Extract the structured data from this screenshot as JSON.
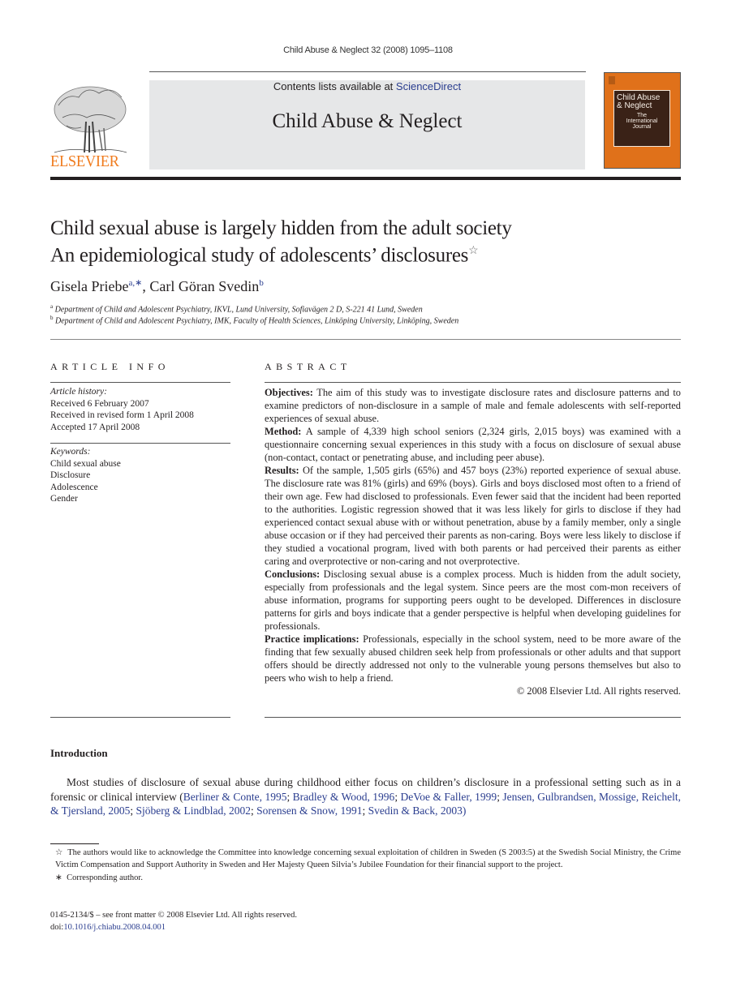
{
  "running_head": "Child Abuse & Neglect 32 (2008) 1095–1108",
  "banner": {
    "publisher_logo_text": "ELSEVIER",
    "contents_prefix": "Contents lists available at ",
    "contents_link": "ScienceDirect",
    "journal_name": "Child Abuse & Neglect",
    "cover": {
      "title_line1": "Child Abuse",
      "title_line2": "& Neglect",
      "subtitle_line1": "The",
      "subtitle_line2": "International",
      "subtitle_line3": "Journal"
    },
    "colors": {
      "logo_orange": "#f07b1d",
      "cover_orange": "#e0711a",
      "cover_brown": "#3a2217",
      "banner_gray": "#e6e7e8",
      "link_blue": "#2a3d8f"
    }
  },
  "article": {
    "title_line1": "Child sexual abuse is largely hidden from the adult society",
    "title_line2": "An epidemiological study of adolescents’ disclosures",
    "title_footnote_mark": "☆",
    "authors": [
      {
        "name": "Gisela Priebe",
        "marks": "a,∗"
      },
      {
        "name": "Carl Göran Svedin",
        "marks": "b"
      }
    ],
    "author_separator": ", ",
    "affiliations": [
      {
        "mark": "a",
        "text": "Department of Child and Adolescent Psychiatry, IKVL, Lund University, Sofiavägen 2 D, S-221 41 Lund, Sweden"
      },
      {
        "mark": "b",
        "text": "Department of Child and Adolescent Psychiatry, IMK, Faculty of Health Sciences, Linköping University, Linköping, Sweden"
      }
    ]
  },
  "article_info": {
    "heading": "ARTICLE INFO",
    "history_label": "Article history:",
    "history": [
      "Received 6 February 2007",
      "Received in revised form 1 April 2008",
      "Accepted 17 April 2008"
    ],
    "keywords_label": "Keywords:",
    "keywords": [
      "Child sexual abuse",
      "Disclosure",
      "Adolescence",
      "Gender"
    ]
  },
  "abstract": {
    "heading": "ABSTRACT",
    "sections": [
      {
        "label": "Objectives:",
        "text": " The aim of this study was to investigate disclosure rates and disclosure patterns and to examine predictors of non-disclosure in a sample of male and female adolescents with self-reported experiences of sexual abuse."
      },
      {
        "label": "Method:",
        "text": " A sample of 4,339 high school seniors (2,324 girls, 2,015 boys) was examined with a questionnaire concerning sexual experiences in this study with a focus on disclosure of sexual abuse (non-contact, contact or penetrating abuse, and including peer abuse)."
      },
      {
        "label": "Results:",
        "text": " Of the sample, 1,505 girls (65%) and 457 boys (23%) reported experience of sexual abuse. The disclosure rate was 81% (girls) and 69% (boys). Girls and boys disclosed most often to a friend of their own age. Few had disclosed to professionals. Even fewer said that the incident had been reported to the authorities. Logistic regression showed that it was less likely for girls to disclose if they had experienced contact sexual abuse with or without penetration, abuse by a family member, only a single abuse occasion or if they had perceived their parents as non-caring. Boys were less likely to disclose if they studied a vocational program, lived with both parents or had perceived their parents as either caring and overprotective or non-caring and not overprotective."
      },
      {
        "label": "Conclusions:",
        "text": " Disclosing sexual abuse is a complex process. Much is hidden from the adult society, especially from professionals and the legal system. Since peers are the most com-mon receivers of abuse information, programs for supporting peers ought to be developed. Differences in disclosure patterns for girls and boys indicate that a gender perspective is helpful when developing guidelines for professionals."
      },
      {
        "label": "Practice implications:",
        "text": " Professionals, especially in the school system, need to be more aware of the finding that few sexually abused children seek help from professionals or other adults and that support offers should be directly addressed not only to the vulnerable young persons themselves but also to peers who wish to help a friend."
      }
    ],
    "copyright": "© 2008 Elsevier Ltd. All rights reserved."
  },
  "introduction": {
    "heading": "Introduction",
    "para_text": "Most studies of disclosure of sexual abuse during childhood either focus on children’s disclosure in a professional setting such as in a forensic or clinical interview (",
    "citations": [
      "Berliner & Conte, 1995",
      "Bradley & Wood, 1996",
      "DeVoe & Faller, 1999",
      "Jensen, Gulbrandsen, Mossige, Reichelt, & Tjersland, 2005",
      "Sjöberg & Lindblad, 2002",
      "Sorensen & Snow, 1991",
      "Svedin & Back, 2003"
    ],
    "citation_separator": "; ",
    "para_close": ")"
  },
  "footnotes": {
    "star_mark": "☆",
    "star_text": "The authors would like to acknowledge the Committee into knowledge concerning sexual exploitation of children in Sweden (S 2003:5) at the Swedish Social Ministry, the Crime Victim Compensation and Support Authority in Sweden and Her Majesty Queen Silvia’s Jubilee Foundation for their financial support to the project.",
    "corr_mark": "∗",
    "corr_text": "Corresponding author."
  },
  "imprint": {
    "line1": "0145-2134/$ – see front matter © 2008 Elsevier Ltd. All rights reserved.",
    "doi_prefix": "doi:",
    "doi": "10.1016/j.chiabu.2008.04.001"
  }
}
